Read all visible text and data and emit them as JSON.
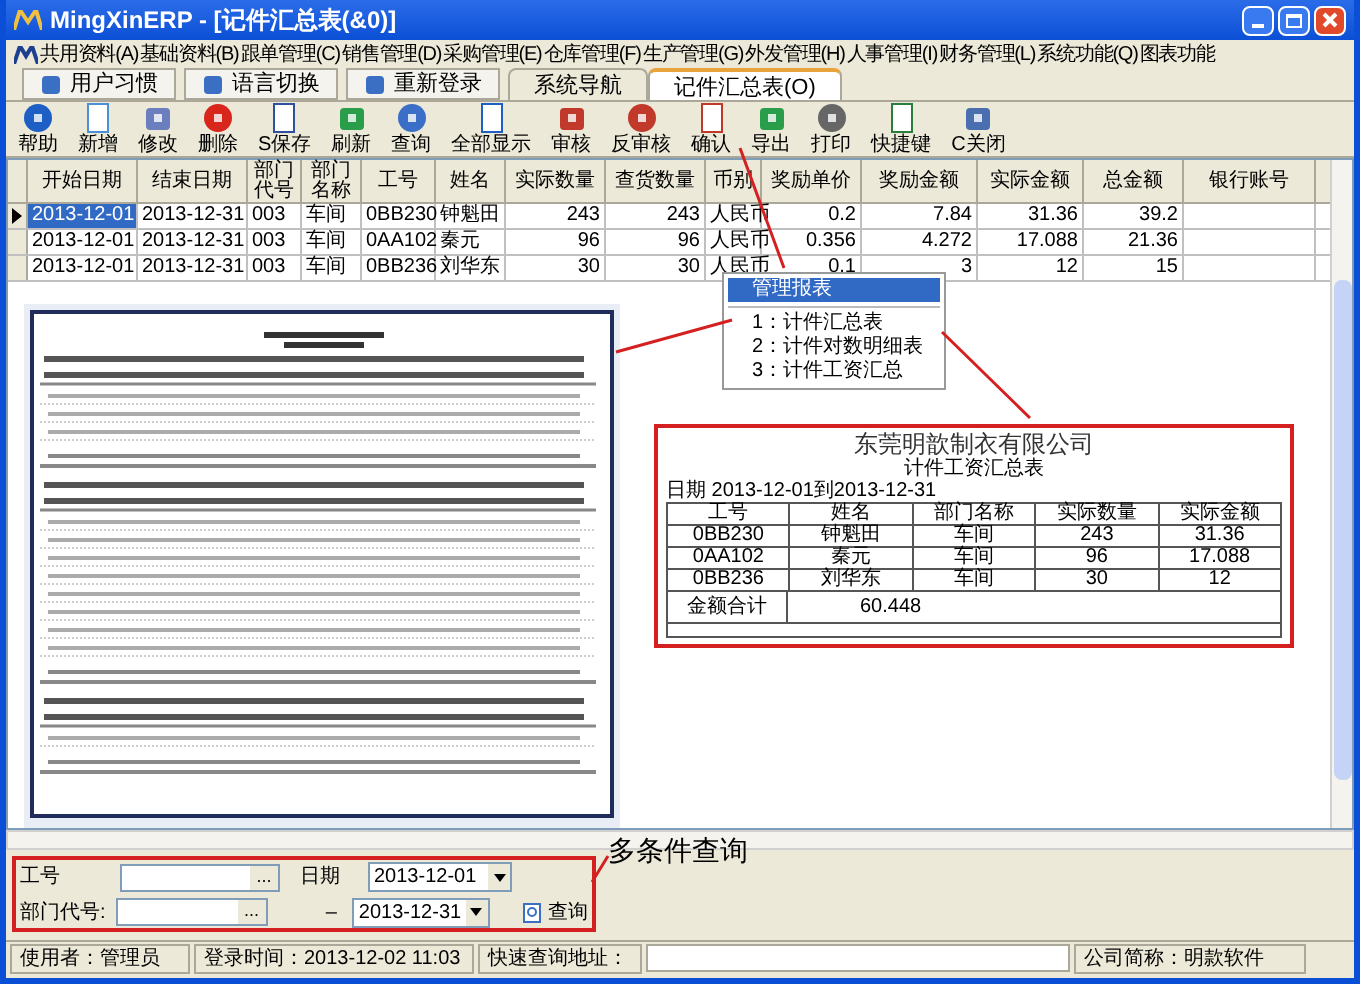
{
  "window": {
    "title": "MingXinERP - [记件汇总表(&0)]"
  },
  "menu": [
    "共用资料(A)",
    "基础资料(B)",
    "跟单管理(C)",
    "销售管理(D)",
    "采购管理(E)",
    "仓库管理(F)",
    "生产管理(G)",
    "外发管理(H)",
    "人事管理(I)",
    "财务管理(L)",
    "系统功能(Q)",
    "图表功能"
  ],
  "nav_tabs": [
    {
      "label": "用户习惯",
      "kind": "button",
      "selected": false
    },
    {
      "label": "语言切换",
      "kind": "button",
      "selected": false
    },
    {
      "label": "重新登录",
      "kind": "button",
      "selected": false
    },
    {
      "label": "系统导航",
      "kind": "tab",
      "selected": false
    },
    {
      "label": "记件汇总表(O)",
      "kind": "tab",
      "selected": true
    }
  ],
  "toolbar": [
    "帮助",
    "新增",
    "修改",
    "删除",
    "S保存",
    "刷新",
    "查询",
    "全部显示",
    "审核",
    "反审核",
    "确认",
    "导出",
    "打印",
    "快捷键",
    "C关闭"
  ],
  "table": {
    "columns": [
      "开始日期",
      "结束日期",
      "部门代号",
      "部门名称",
      "工号",
      "姓名",
      "实际数量",
      "查货数量",
      "币别",
      "奖励单价",
      "奖励金额",
      "实际金额",
      "总金额",
      "银行账号"
    ],
    "rows": [
      {
        "selected": true,
        "cells": [
          "2013-12-01",
          "2013-12-31",
          "003",
          "车间",
          "0BB230",
          "钟魁田",
          "243",
          "243",
          "人民币",
          "0.2",
          "7.84",
          "31.36",
          "39.2",
          ""
        ]
      },
      {
        "selected": false,
        "cells": [
          "2013-12-01",
          "2013-12-31",
          "003",
          "车间",
          "0AA102",
          "秦元",
          "96",
          "96",
          "人民币",
          "0.356",
          "4.272",
          "17.088",
          "21.36",
          ""
        ]
      },
      {
        "selected": false,
        "cells": [
          "2013-12-01",
          "2013-12-31",
          "003",
          "车间",
          "0BB236",
          "刘华东",
          "30",
          "30",
          "人民币",
          "0.1",
          "3",
          "12",
          "15",
          ""
        ]
      }
    ]
  },
  "report_menu": {
    "title": "管理报表",
    "items": [
      "1：计件汇总表",
      "2：计件对数明细表",
      "3：计件工资汇总"
    ]
  },
  "summary_report": {
    "company": "东莞明歆制衣有限公司",
    "title": "计件工资汇总表",
    "date_range": "日期 2013-12-01到2013-12-31",
    "columns": [
      "工号",
      "姓名",
      "部门名称",
      "实际数量",
      "实际金额"
    ],
    "rows": [
      [
        "0BB230",
        "钟魁田",
        "车间",
        "243",
        "31.36"
      ],
      [
        "0AA102",
        "秦元",
        "车间",
        "96",
        "17.088"
      ],
      [
        "0BB236",
        "刘华东",
        "车间",
        "30",
        "12"
      ]
    ],
    "total_label": "金额合计",
    "total_value": "60.448"
  },
  "query_note": "多条件查询",
  "query": {
    "employee_label": "工号",
    "dept_label": "部门代号:",
    "browse": "...",
    "date_label": "日期",
    "date_from": "2013-12-01",
    "range_dash": "–",
    "date_to": "2013-12-31",
    "search_button": "查询"
  },
  "status_bar": {
    "user": "使用者：管理员",
    "login": "登录时间：2013-12-02 11:03",
    "quick_label": "快速查询地址：",
    "company": "公司简称：明款软件"
  }
}
